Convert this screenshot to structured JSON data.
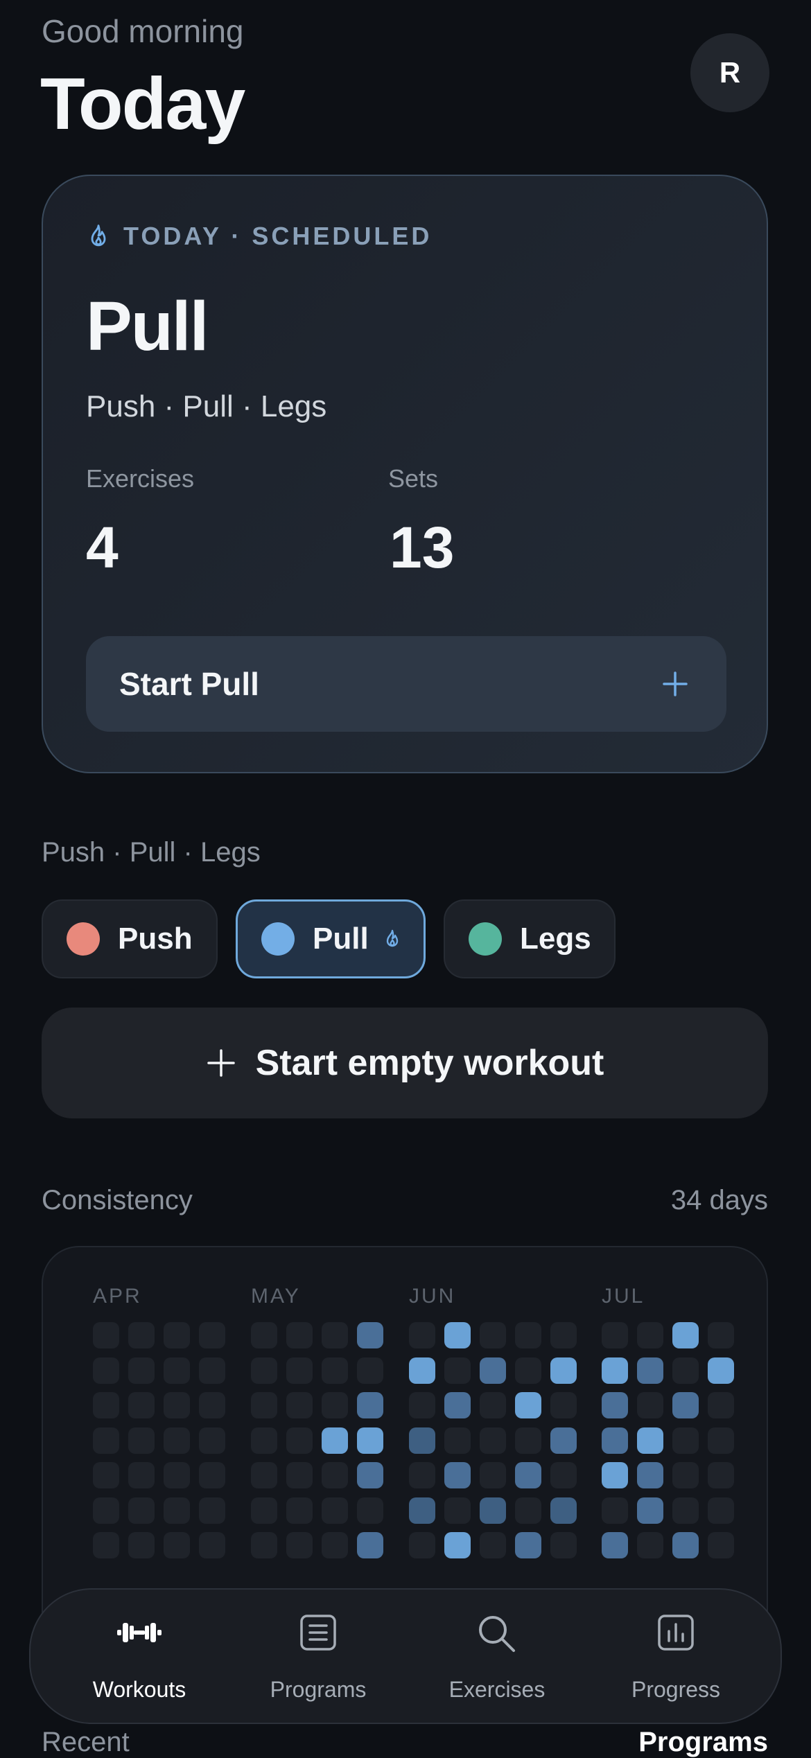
{
  "header": {
    "greeting": "Good morning",
    "title": "Today",
    "avatar_initial": "R"
  },
  "hero": {
    "tag": "TODAY · SCHEDULED",
    "workout_name": "Pull",
    "program": "Push · Pull · Legs",
    "stats": [
      {
        "label": "Exercises",
        "value": "4"
      },
      {
        "label": "Sets",
        "value": "13"
      }
    ],
    "start_label": "Start Pull",
    "icon": "flame-icon",
    "action_icon": "plus-icon"
  },
  "program_section": {
    "label": "Push · Pull · Legs",
    "chips": [
      {
        "label": "Push",
        "color": "#e8897c",
        "active": false
      },
      {
        "label": "Pull",
        "color": "#73aee6",
        "active": true
      },
      {
        "label": "Legs",
        "color": "#56b59d",
        "active": false
      }
    ]
  },
  "empty_workout": {
    "label": "Start empty workout",
    "icon": "plus-icon"
  },
  "consistency": {
    "label": "Consistency",
    "count": "34 days",
    "months": [
      "APR",
      "MAY",
      "JUN",
      "JUL"
    ],
    "colors": {
      "empty": "#1f232a",
      "low": "#3e5f82",
      "mid": "#4a6f98",
      "high": "#6aa2d6"
    },
    "weeks": [
      [
        0,
        0,
        0,
        0,
        0,
        0,
        0
      ],
      [
        0,
        0,
        0,
        0,
        0,
        0,
        0
      ],
      [
        0,
        0,
        0,
        0,
        0,
        0,
        0
      ],
      [
        0,
        0,
        0,
        0,
        0,
        0,
        0
      ],
      [
        0,
        0,
        0,
        0,
        0,
        0,
        0
      ],
      [
        0,
        0,
        0,
        0,
        0,
        0,
        0
      ],
      [
        0,
        0,
        0,
        3,
        0,
        0,
        0
      ],
      [
        2,
        0,
        2,
        3,
        2,
        0,
        2
      ],
      [
        0,
        3,
        0,
        1,
        0,
        1,
        0
      ],
      [
        3,
        0,
        2,
        0,
        2,
        0,
        3
      ],
      [
        0,
        2,
        0,
        0,
        0,
        1,
        0
      ],
      [
        0,
        0,
        3,
        0,
        2,
        0,
        2
      ],
      [
        0,
        3,
        0,
        2,
        0,
        1,
        0
      ],
      [
        0,
        3,
        2,
        2,
        3,
        0,
        2
      ],
      [
        0,
        2,
        0,
        3,
        2,
        2,
        0
      ],
      [
        3,
        0,
        2,
        0,
        0,
        0,
        2
      ],
      [
        0,
        3,
        0,
        0,
        0,
        0,
        0
      ]
    ]
  },
  "nav": {
    "items": [
      {
        "label": "Workouts",
        "icon": "dumbbell-icon",
        "active": true
      },
      {
        "label": "Programs",
        "icon": "list-icon",
        "active": false
      },
      {
        "label": "Exercises",
        "icon": "search-icon",
        "active": false
      },
      {
        "label": "Progress",
        "icon": "chart-icon",
        "active": false
      }
    ]
  },
  "footer_peek": {
    "left": "Recent",
    "right": "Programs"
  }
}
